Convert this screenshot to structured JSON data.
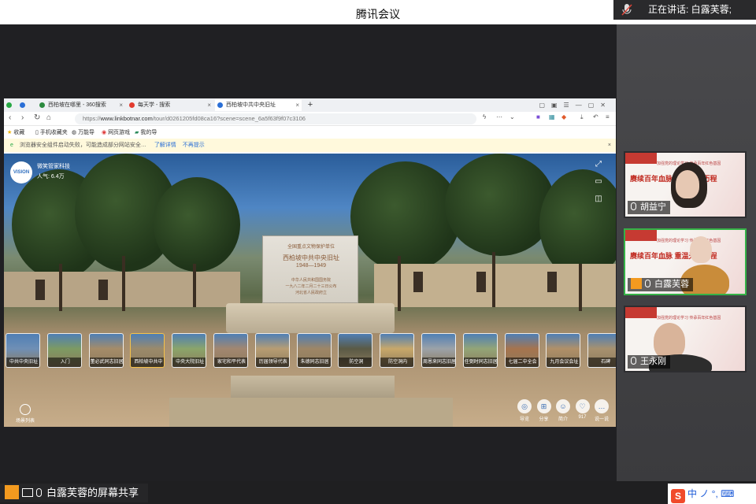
{
  "app": {
    "title": "腾讯会议"
  },
  "speaking": {
    "label": "正在讲话: 白露芙蓉;"
  },
  "browser": {
    "tabs": [
      {
        "label": "西柏坡在哪里 - 360搜索",
        "color": "#2b8a3e"
      },
      {
        "label": "每天学 - 搜索",
        "color": "#e23b2e"
      },
      {
        "label": "西柏坡中共中央旧址",
        "color": "#2a6fd6"
      }
    ],
    "url_prefix": "https://",
    "url_domain": "www.linkbotnar.com",
    "url_path": "/tour/d0261205fd08ca16?scene=scene_6a5f63f9f07c3106",
    "bookmarks": [
      "收藏",
      "手机收藏夹",
      "万能导",
      "网页游戏",
      "我的导"
    ],
    "infobar_text": "浏览器安全组件启动失败，可能造成部分网站安全…",
    "infobar_link1": "了解详情",
    "infobar_link2": "不再提示"
  },
  "pano": {
    "logo_text": "VISION",
    "site_name": "微笑管家科技",
    "popularity": "人气: 6.4万",
    "monument_lines": [
      "全国重点文物保护单位",
      "西柏坡中共中央旧址",
      "1948—1949",
      "中华人民共和国国务院",
      "一九八二年二月二十三日公布",
      "河北省人民政府立"
    ],
    "thumbnails": [
      {
        "label": "中共中央旧址",
        "color": "#6f8fb5"
      },
      {
        "label": "入门",
        "color": "#7d9a63"
      },
      {
        "label": "董必武同志旧居",
        "color": "#a58c69"
      },
      {
        "label": "西柏坡中共中",
        "color": "#9b8a6b",
        "selected": true
      },
      {
        "label": "中央大院旧址",
        "color": "#8ba56a"
      },
      {
        "label": "家宅和平代表",
        "color": "#a28770"
      },
      {
        "label": "历届领导代表",
        "color": "#b79d73"
      },
      {
        "label": "朱德同志旧居",
        "color": "#9e8666"
      },
      {
        "label": "防空洞",
        "color": "#5a5a45"
      },
      {
        "label": "防空洞内",
        "color": "#c8a86a"
      },
      {
        "label": "周恩来同志旧居",
        "color": "#9ca2a8"
      },
      {
        "label": "任弼时同志旧居",
        "color": "#93a577"
      },
      {
        "label": "七届二中全会",
        "color": "#a6744e"
      },
      {
        "label": "九月会议会址",
        "color": "#b09068"
      },
      {
        "label": "石碑",
        "color": "#a7916f"
      }
    ],
    "scene_btn": "场景列表",
    "controls": [
      {
        "label": "导览",
        "icon": "◎"
      },
      {
        "label": "分享",
        "icon": "⊞"
      },
      {
        "label": "简介",
        "icon": "☺"
      },
      {
        "label": "917",
        "icon": "♡"
      },
      {
        "label": "说一说",
        "icon": "…"
      }
    ]
  },
  "participants": [
    {
      "name": "胡益宁",
      "banner_big": "赓续百年血脉 重温光辉历程",
      "banner_small": "加强党的理论学习 传承百年红色基因"
    },
    {
      "name": "白露芙蓉",
      "banner_big": "赓续百年血脉 重温光辉历程",
      "banner_small": "加强党的理论学习 传承百年红色基因",
      "host": true,
      "active": true
    },
    {
      "name": "王永刚",
      "banner_big": "",
      "banner_small": "加强党的理论学习 传承百年红色基因"
    }
  ],
  "bottom": {
    "share_label": "白露芙蓉的屏幕共享"
  },
  "ime": {
    "logo": "S",
    "text": "中 ノ °, ⌨"
  }
}
